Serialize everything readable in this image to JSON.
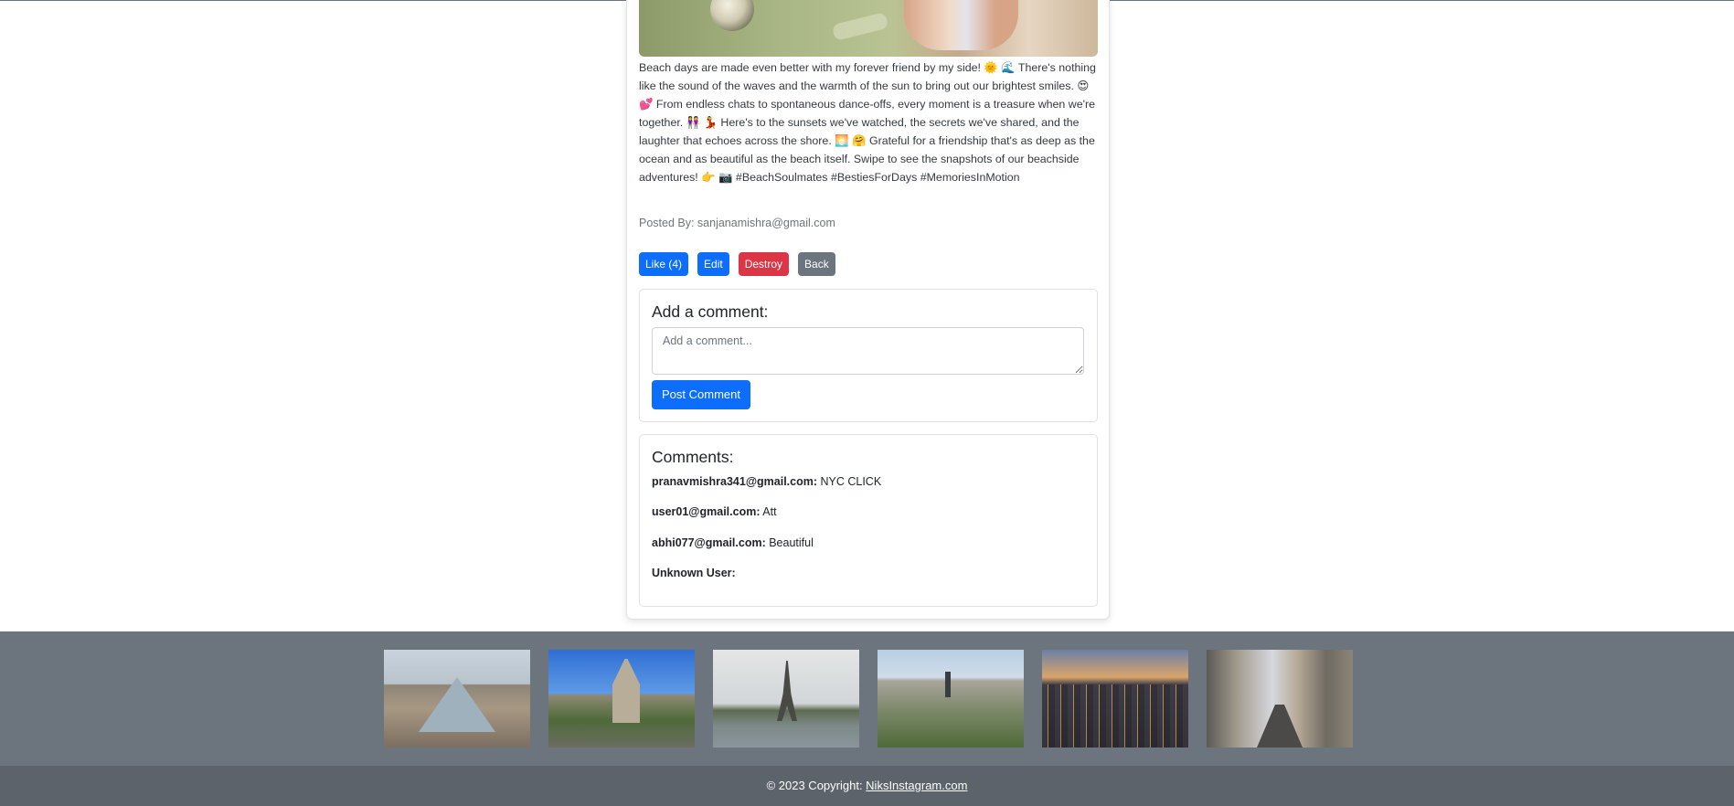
{
  "post": {
    "image_alt": "Beach photo with scooter",
    "caption": "Beach days are made even better with my forever friend by my side! 🌞 🌊 There's nothing like the sound of the waves and the warmth of the sun to bring out our brightest smiles. 😍 💕 From endless chats to spontaneous dance-offs, every moment is a treasure when we're together. 👭 💃 Here's to the sunsets we've watched, the secrets we've shared, and the laughter that echoes across the shore. 🌅 🤗 Grateful for a friendship that's as deep as the ocean and as beautiful as the beach itself. Swipe to see the snapshots of our beachside adventures! 👉 📷 #BeachSoulmates #BestiesForDays #MemoriesInMotion",
    "posted_by": "Posted By: sanjanamishra@gmail.com"
  },
  "actions": {
    "like_label": "Like (4)",
    "edit_label": "Edit",
    "destroy_label": "Destroy",
    "back_label": "Back"
  },
  "comment_form": {
    "title": "Add a comment:",
    "placeholder": "Add a comment...",
    "value": "",
    "submit_label": "Post Comment"
  },
  "comments": {
    "title": "Comments:",
    "items": [
      {
        "user": "pranavmishra341@gmail.com:",
        "text": " NYC CLICK"
      },
      {
        "user": "user01@gmail.com:",
        "text": " Att"
      },
      {
        "user": "abhi077@gmail.com:",
        "text": " Beautiful"
      },
      {
        "user": "Unknown User:",
        "text": ""
      }
    ]
  },
  "gallery": {
    "images": [
      "Louvre Pyramid",
      "Notre-Dame",
      "Eiffel Tower",
      "Paris skyline",
      "New York City at dusk",
      "Paris street"
    ]
  },
  "footer": {
    "prefix": "© 2023 Copyright: ",
    "link": "NiksInstagram.com"
  },
  "colors": {
    "primary": "#0d6efd",
    "danger": "#dc3545",
    "secondary": "#6c757d",
    "footer_bg": "#5c636a"
  }
}
